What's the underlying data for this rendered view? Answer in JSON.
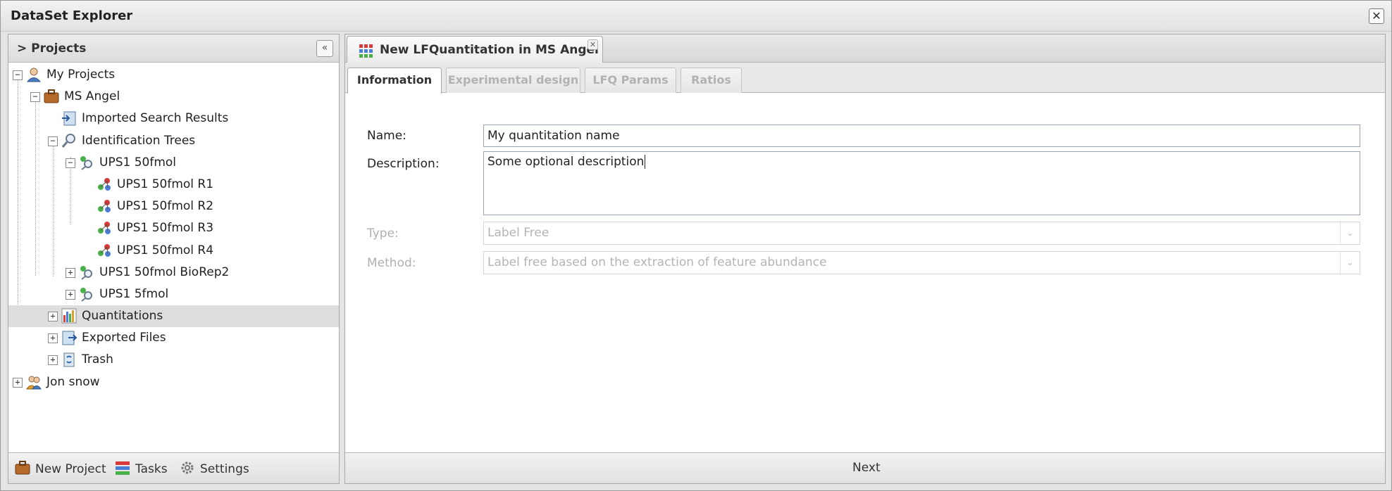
{
  "window": {
    "title": "DataSet Explorer"
  },
  "projects_panel": {
    "title": "> Projects",
    "tree": [
      {
        "label": "My Projects"
      },
      {
        "label": "MS Angel"
      },
      {
        "label": "Imported Search Results"
      },
      {
        "label": "Identification Trees"
      },
      {
        "label": "UPS1 50fmol"
      },
      {
        "label": "UPS1 50fmol R1"
      },
      {
        "label": "UPS1 50fmol R2"
      },
      {
        "label": "UPS1 50fmol R3"
      },
      {
        "label": "UPS1 50fmol R4"
      },
      {
        "label": "UPS1 50fmol BioRep2"
      },
      {
        "label": "UPS1 5fmol"
      },
      {
        "label": "Quantitations"
      },
      {
        "label": "Exported Files"
      },
      {
        "label": "Trash"
      },
      {
        "label": "Jon snow"
      }
    ],
    "footer": {
      "new_project": "New Project",
      "tasks": "Tasks",
      "settings": "Settings"
    }
  },
  "document_tab": {
    "title": "New LFQuantitation in MS Angel"
  },
  "subtabs": [
    {
      "label": "Information"
    },
    {
      "label": "Experimental design"
    },
    {
      "label": "LFQ Params"
    },
    {
      "label": "Ratios"
    }
  ],
  "form": {
    "name_label": "Name:",
    "name_value": "My quantitation name",
    "description_label": "Description:",
    "description_value": "Some optional description",
    "type_label": "Type:",
    "type_value": "Label Free",
    "method_label": "Method:",
    "method_value": "Label free based on the extraction of feature abundance"
  },
  "footer": {
    "next_label": "Next"
  }
}
